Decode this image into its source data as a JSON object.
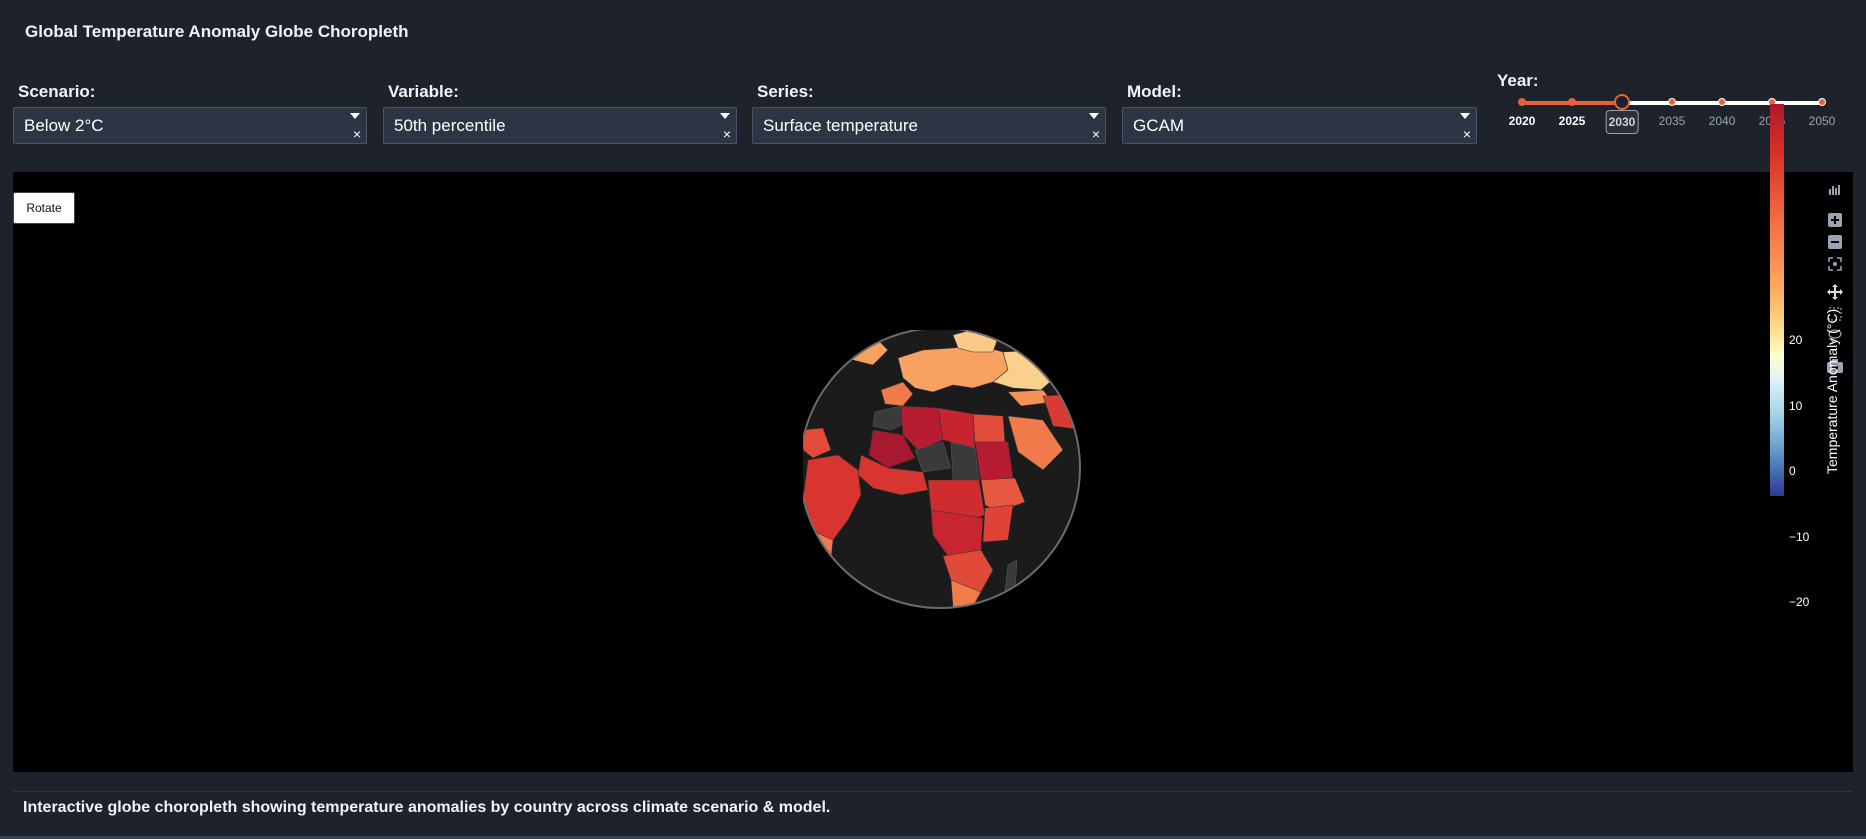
{
  "app": {
    "title": "Global Temperature Anomaly Globe Choropleth"
  },
  "controls": {
    "scenario": {
      "label": "Scenario:",
      "value": "Below 2°C"
    },
    "variable": {
      "label": "Variable:",
      "value": "50th percentile"
    },
    "series": {
      "label": "Series:",
      "value": "Surface temperature"
    },
    "model": {
      "label": "Model:",
      "value": "GCAM"
    },
    "year": {
      "label": "Year:",
      "marks": [
        "2020",
        "2025",
        "2030",
        "2035",
        "2040",
        "2045",
        "2050"
      ],
      "selected": "2030"
    }
  },
  "plot": {
    "rotate_label": "Rotate",
    "colorbar": {
      "title": "Temperature Anomaly (°C)",
      "ticks": [
        "20",
        "10",
        "0",
        "−10",
        "−20"
      ]
    }
  },
  "footer": {
    "text": "Interactive globe choropleth showing temperature anomalies by country across climate scenario & model."
  },
  "colors": {
    "accent": "#e8613a",
    "plot_bg": "#000000",
    "page_bg": "#1e222b",
    "land_nodata": "#1b1b1b"
  }
}
